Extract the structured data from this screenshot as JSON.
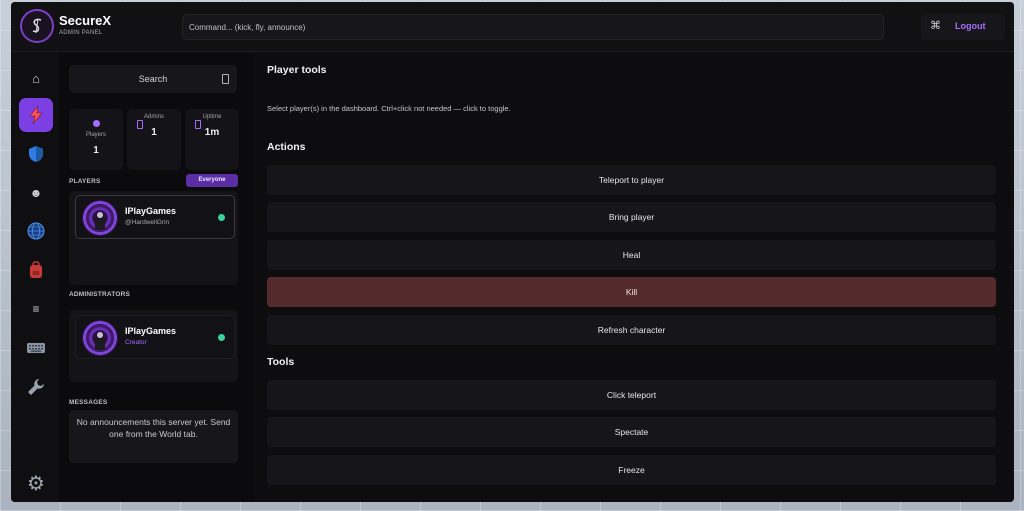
{
  "app": {
    "name": "SecureX",
    "subtitle": "ADMIN PANEL",
    "accent": "#7b3fe4",
    "danger": "#552a2c",
    "online": "#3ed39a"
  },
  "header": {
    "command_placeholder": "Command... (kick, fly, announce)",
    "command_icon": "command-icon",
    "logout_label": "Logout"
  },
  "rail": {
    "items": [
      {
        "name": "home-icon"
      },
      {
        "name": "lightning-icon",
        "active": true
      },
      {
        "name": "shield-icon"
      },
      {
        "name": "face-icon"
      },
      {
        "name": "globe-icon"
      },
      {
        "name": "backpack-icon"
      },
      {
        "name": "menu-icon"
      },
      {
        "name": "keyboard-icon"
      },
      {
        "name": "wrench-icon"
      },
      {
        "name": "gear-icon"
      }
    ]
  },
  "sidebar": {
    "search_label": "Search",
    "stats": [
      {
        "label": "Players",
        "value": "1"
      },
      {
        "label": "Admins",
        "value": "1"
      },
      {
        "label": "Uptime",
        "value": "1m"
      }
    ],
    "players_label": "PLAYERS",
    "players_filter": "Everyone",
    "players": [
      {
        "name": "IPlayGames",
        "handle": "@HardwellGrin"
      }
    ],
    "admins_label": "ADMINISTRATORS",
    "admins": [
      {
        "name": "IPlayGames",
        "role": "Creator"
      }
    ],
    "messages_label": "MESSAGES",
    "messages_text": "No announcements this server yet. Send one from the World tab."
  },
  "main": {
    "title": "Player tools",
    "description": "Select player(s) in the dashboard. Ctrl+click not needed — click to toggle.",
    "actions_label": "Actions",
    "actions": [
      "Teleport to player",
      "Bring player",
      "Heal",
      "Kill",
      "Refresh character"
    ],
    "tools_label": "Tools",
    "tools": [
      "Click teleport",
      "Spectate",
      "Freeze"
    ]
  }
}
